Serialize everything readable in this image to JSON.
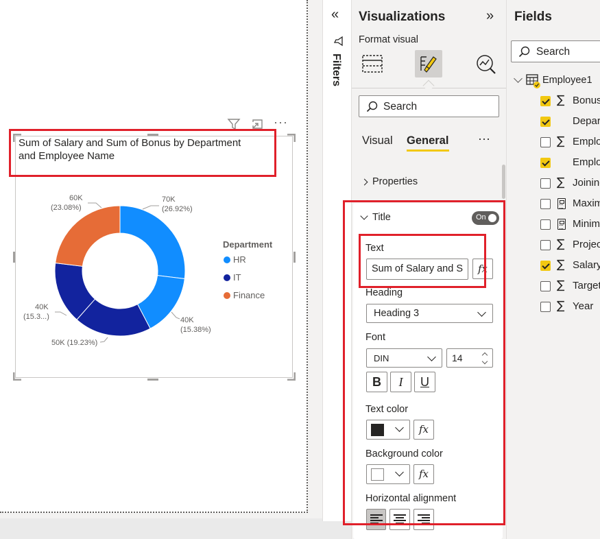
{
  "visual": {
    "title": "Sum of Salary and Sum of Bonus by Department and Employee Name",
    "title_line1": "Sum of Salary and Sum of Bonus by Department",
    "title_line2": "and Employee Name"
  },
  "chart_data": {
    "type": "pie",
    "variant": "donut",
    "title": "Sum of Salary and Sum of Bonus by Department and Employee Name",
    "legend_title": "Department",
    "legend_position": "right",
    "legend": [
      "HR",
      "IT",
      "Finance"
    ],
    "slices": [
      {
        "department": "HR",
        "value": 70000,
        "label": "70K",
        "percent": "(26.92%)",
        "color": "#118dff"
      },
      {
        "department": "HR",
        "value": 40000,
        "label": "40K",
        "percent": "(15.38%)",
        "color": "#118dff"
      },
      {
        "department": "IT",
        "value": 50000,
        "label": "50K (19.23%)",
        "percent": "(19.23%)",
        "color": "#12239e"
      },
      {
        "department": "IT",
        "value": 40000,
        "label": "40K",
        "percent": "(15.3...)",
        "color": "#12239e"
      },
      {
        "department": "Finance",
        "value": 60000,
        "label": "60K",
        "percent": "(23.08%)",
        "color": "#e66c37"
      }
    ]
  },
  "colors": {
    "HR": "#118dff",
    "IT": "#12239e",
    "Finance": "#e66c37",
    "highlight": "#e0202a",
    "accent": "#f2c811"
  },
  "filters": {
    "label": "Filters"
  },
  "viz_pane": {
    "title": "Visualizations",
    "subtitle": "Format visual",
    "search_placeholder": "Search",
    "tabs": [
      "Visual",
      "General"
    ],
    "active_tab": "General",
    "more": "···",
    "properties_label": "Properties",
    "title_section": "Title",
    "toggle_label": "On",
    "text_label": "Text",
    "text_value": "Sum of Salary and S",
    "fx": "fx",
    "heading_label": "Heading",
    "heading_value": "Heading 3",
    "font_label": "Font",
    "font_value": "DIN",
    "font_size": "14",
    "bold": "B",
    "italic": "I",
    "underline": "U",
    "text_color_label": "Text color",
    "bg_color_label": "Background color",
    "h_align_label": "Horizontal alignment"
  },
  "fields_pane": {
    "title": "Fields",
    "search_placeholder": "Search",
    "table_name": "Employee1",
    "items": [
      {
        "label": "Bonus",
        "checked": true,
        "icon": "sigma"
      },
      {
        "label": "Depar",
        "checked": true,
        "icon": "none"
      },
      {
        "label": "Emplo",
        "checked": false,
        "icon": "sigma"
      },
      {
        "label": "Emplo",
        "checked": true,
        "icon": "none"
      },
      {
        "label": "Joining",
        "checked": false,
        "icon": "sigma"
      },
      {
        "label": "Maxim",
        "checked": false,
        "icon": "calculator"
      },
      {
        "label": "Minim",
        "checked": false,
        "icon": "calculator"
      },
      {
        "label": "Projec",
        "checked": false,
        "icon": "sigma"
      },
      {
        "label": "Salary",
        "checked": true,
        "icon": "sigma"
      },
      {
        "label": "Target",
        "checked": false,
        "icon": "sigma"
      },
      {
        "label": "Year",
        "checked": false,
        "icon": "sigma"
      }
    ]
  }
}
